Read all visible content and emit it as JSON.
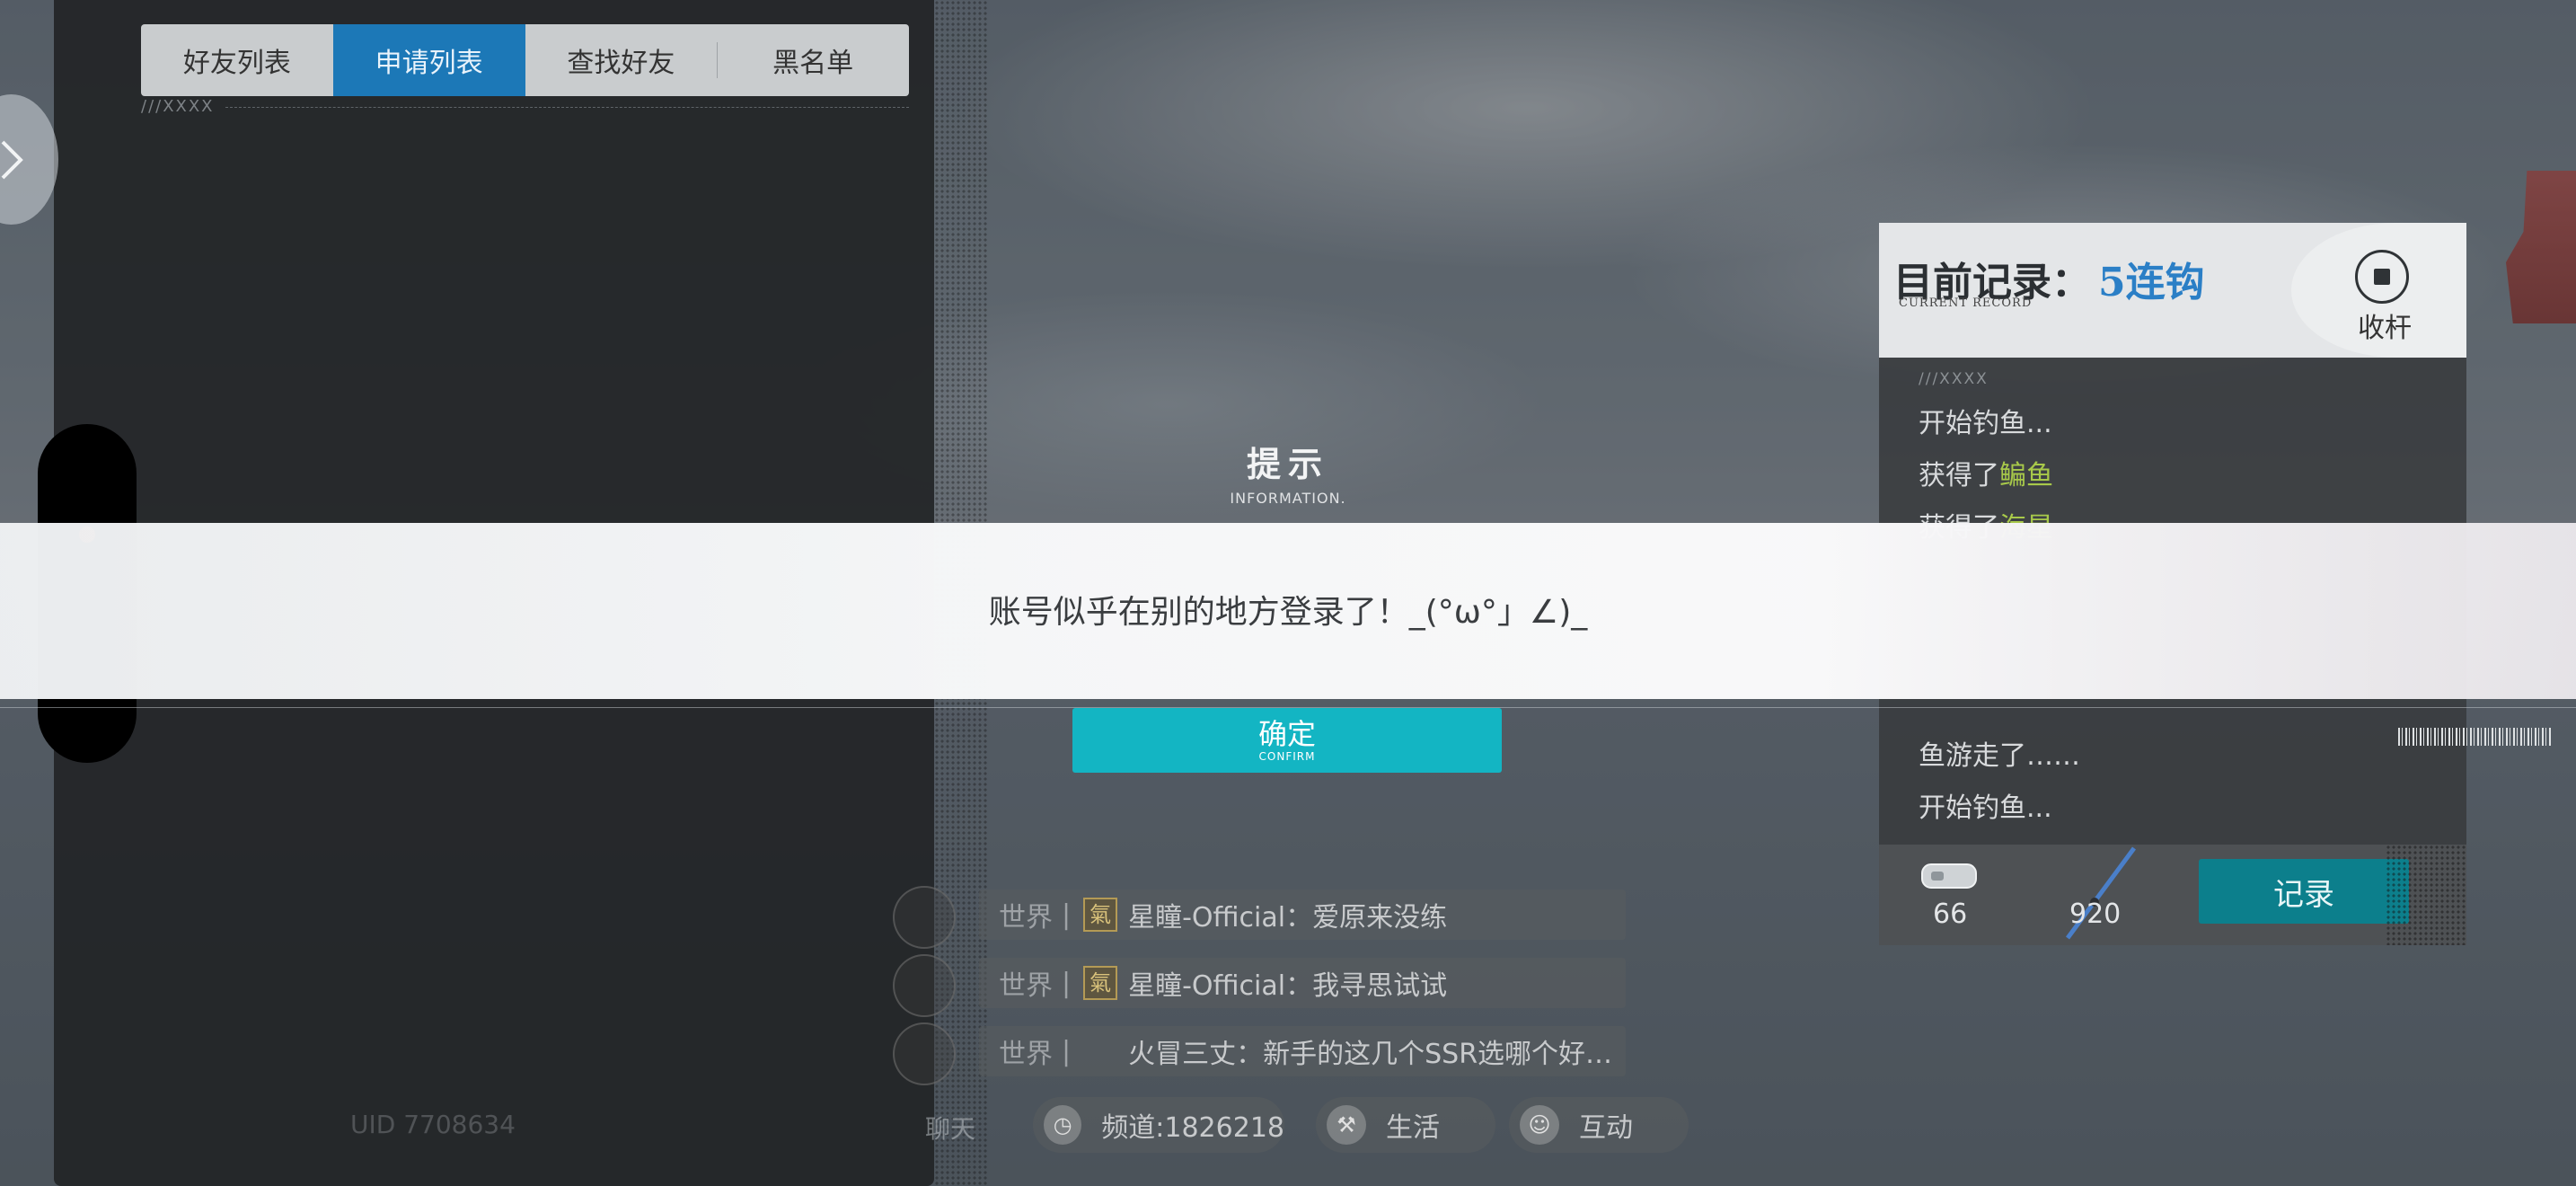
{
  "friends": {
    "tabs": [
      {
        "label": "好友列表",
        "active": false
      },
      {
        "label": "申请列表",
        "active": true
      },
      {
        "label": "查找好友",
        "active": false
      },
      {
        "label": "黑名单",
        "active": false
      }
    ],
    "deco": "///XXXX"
  },
  "record": {
    "title": "目前记录：",
    "value": "5连钩",
    "subtitle": "CURRENT RECORD",
    "stop_label": "收杆",
    "log_deco": "///XXXX",
    "log": [
      {
        "prefix": "开始钓鱼...",
        "fish": ""
      },
      {
        "prefix": "获得了",
        "fish": "鳊鱼"
      },
      {
        "prefix": "获得了",
        "fish": "海星"
      },
      {
        "prefix": "鱼游走了……",
        "fish": ""
      },
      {
        "prefix": "开始钓鱼...",
        "fish": ""
      }
    ],
    "bait_count": "66",
    "rod_count": "920",
    "record_button": "记录"
  },
  "chat": {
    "messages": [
      {
        "channel": "世界",
        "badge": "氣",
        "text": "星瞳-Official：爱原来没练"
      },
      {
        "channel": "世界",
        "badge": "氣",
        "text": "星瞳-Official：我寻思试试"
      },
      {
        "channel": "世界",
        "badge": "",
        "text": "火冒三丈：新手的这几个SSR选哪个好…"
      }
    ],
    "bottom": {
      "chat_label": "聊天",
      "channel_label": "频道:1826218",
      "life_label": "生活",
      "interact_label": "互动",
      "uid_label": "UID 7708634"
    }
  },
  "dialog": {
    "title": "提示",
    "subtitle": "INFORMATION.",
    "message": "账号似乎在别的地方登录了！_(°ω°」∠)_",
    "confirm_label": "确定",
    "confirm_sub": "CONFIRM"
  },
  "colors": {
    "accent": "#13b5c3",
    "tab_active": "#1c78b7",
    "record_value": "#2b7fc6",
    "fish_name": "#a8c94a",
    "status_dot": "#e8421f"
  }
}
